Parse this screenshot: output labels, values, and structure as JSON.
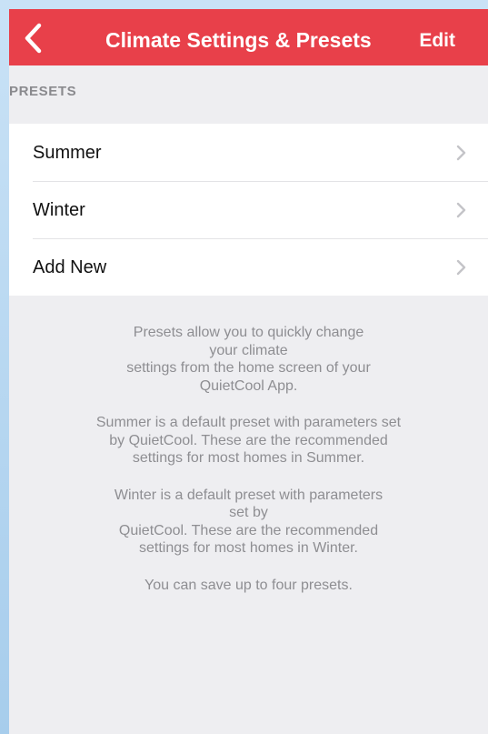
{
  "navbar": {
    "back_icon": "chevron-left-icon",
    "title": "Climate Settings & Presets",
    "edit_label": "Edit",
    "color": "#e8404a"
  },
  "presets_section": {
    "header": "PRESETS",
    "items": [
      {
        "label": "Summer",
        "icon": "chevron-right-icon"
      },
      {
        "label": "Winter",
        "icon": "chevron-right-icon"
      },
      {
        "label": "Add New",
        "icon": "chevron-right-icon"
      }
    ]
  },
  "info": {
    "paragraphs": [
      [
        "Presets allow you to quickly change",
        "your climate",
        "settings from the home screen of your",
        "QuietCool App."
      ],
      [
        "Summer is a default preset with parameters set",
        "by QuietCool. These are the recommended",
        "settings for most homes in Summer."
      ],
      [
        "Winter is a default preset with parameters",
        "set by",
        "QuietCool. These are the recommended",
        "settings for most homes in Winter."
      ],
      [
        "You can save up to four presets."
      ]
    ]
  }
}
